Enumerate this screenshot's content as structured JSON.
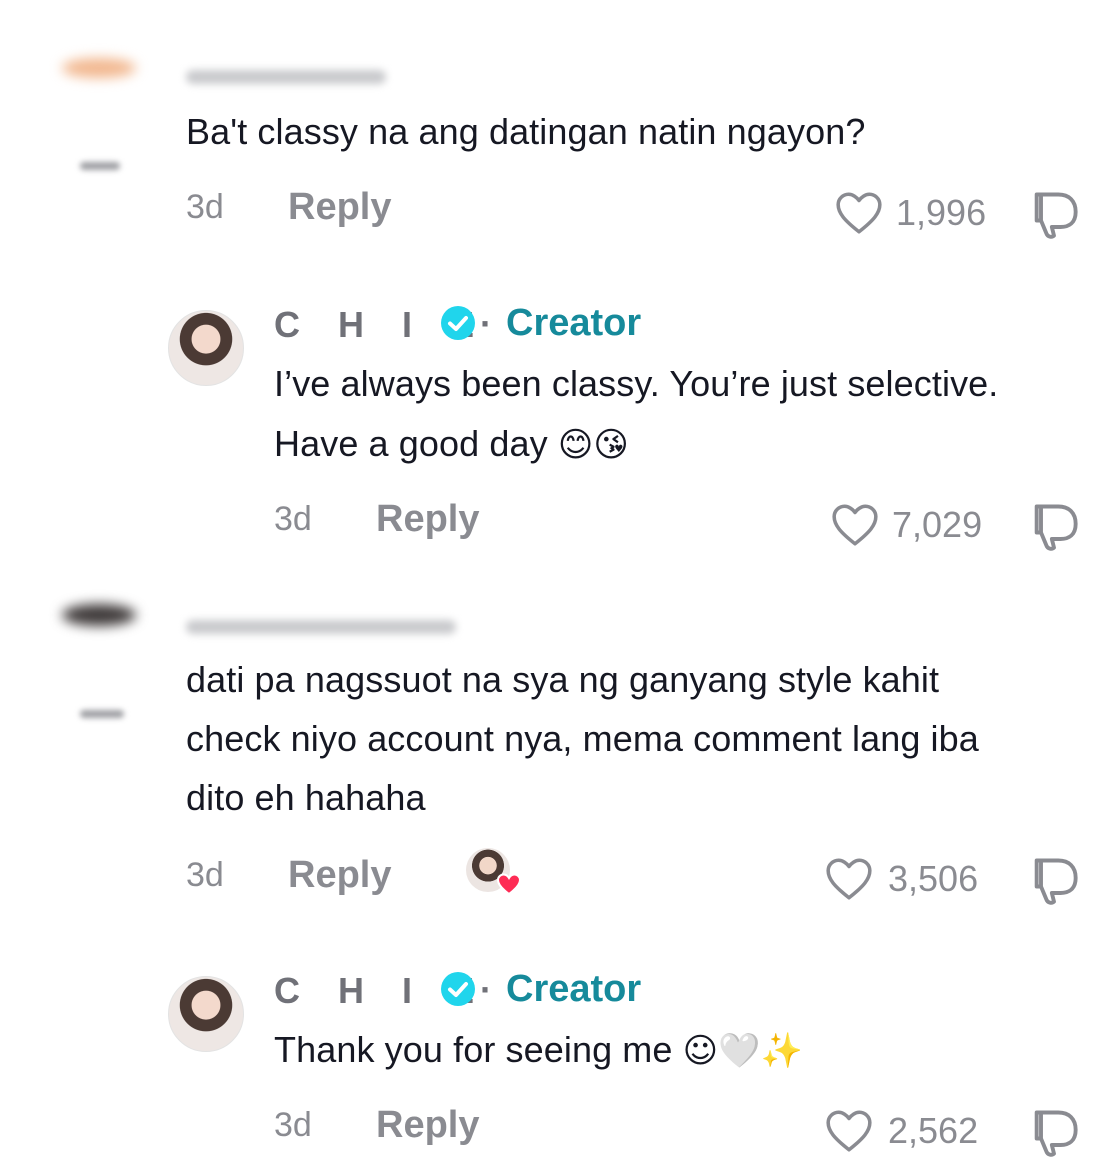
{
  "comments": [
    {
      "text": "Ba't classy na ang datingan natin ngayon?",
      "time": "3d",
      "reply_label": "Reply",
      "likes": "1,996"
    },
    {
      "author": "C H I E",
      "badge": "Creator",
      "text_line1": "I’ve always been classy. You’re just selective.",
      "text_line2": "Have a good day",
      "emojis": "😊😘",
      "time": "3d",
      "reply_label": "Reply",
      "likes": "7,029"
    },
    {
      "text_line1": "dati pa nagssuot na sya ng ganyang style kahit",
      "text_line2": "check niyo account nya, mema comment lang iba",
      "text_line3": "dito eh hahaha",
      "time": "3d",
      "reply_label": "Reply",
      "likes": "3,506"
    },
    {
      "author": "C H I E",
      "badge": "Creator",
      "text": "Thank you for seeing me",
      "emojis": "☺🤍✨",
      "time": "3d",
      "reply_label": "Reply",
      "likes": "2,562"
    }
  ],
  "colors": {
    "accent": "#168a9b",
    "verified": "#20d5ec",
    "muted": "#8a8b91",
    "text": "#161823",
    "liked_heart": "#fe2c55"
  },
  "icons": {
    "like": "heart-outline-icon",
    "dislike": "thumbs-down-icon",
    "verified": "verified-check-icon",
    "creator_liked": "creator-liked-heart-icon"
  }
}
